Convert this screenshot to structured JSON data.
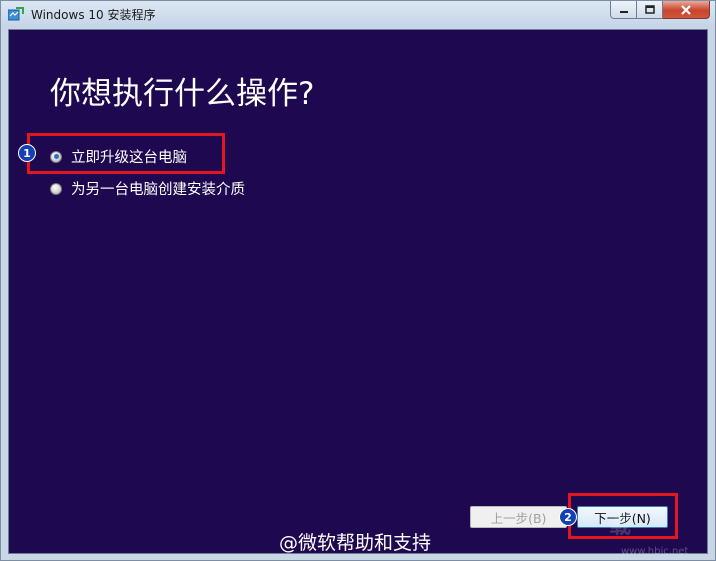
{
  "window": {
    "title": "Windows 10 安装程序",
    "controls": {
      "minimize": "minimize",
      "maximize": "maximize",
      "close": "close"
    }
  },
  "page": {
    "heading": "你想执行什么操作?",
    "options": [
      {
        "label": "立即升级这台电脑",
        "selected": true
      },
      {
        "label": "为另一台电脑创建安装介质",
        "selected": false
      }
    ]
  },
  "annotations": {
    "step1": "1",
    "step2": "2",
    "highlight_color": "#e3161f",
    "badge_color": "#1540b5"
  },
  "buttons": {
    "back": "上一步(B)",
    "next": "下一步(N)"
  },
  "watermark": {
    "text": "@微软帮助和支持",
    "corner": "载",
    "corner_url": "www.hbic.net"
  },
  "colors": {
    "background": "#1e0850",
    "titlebar": "#c5d4e6",
    "close_button": "#c9442c"
  }
}
